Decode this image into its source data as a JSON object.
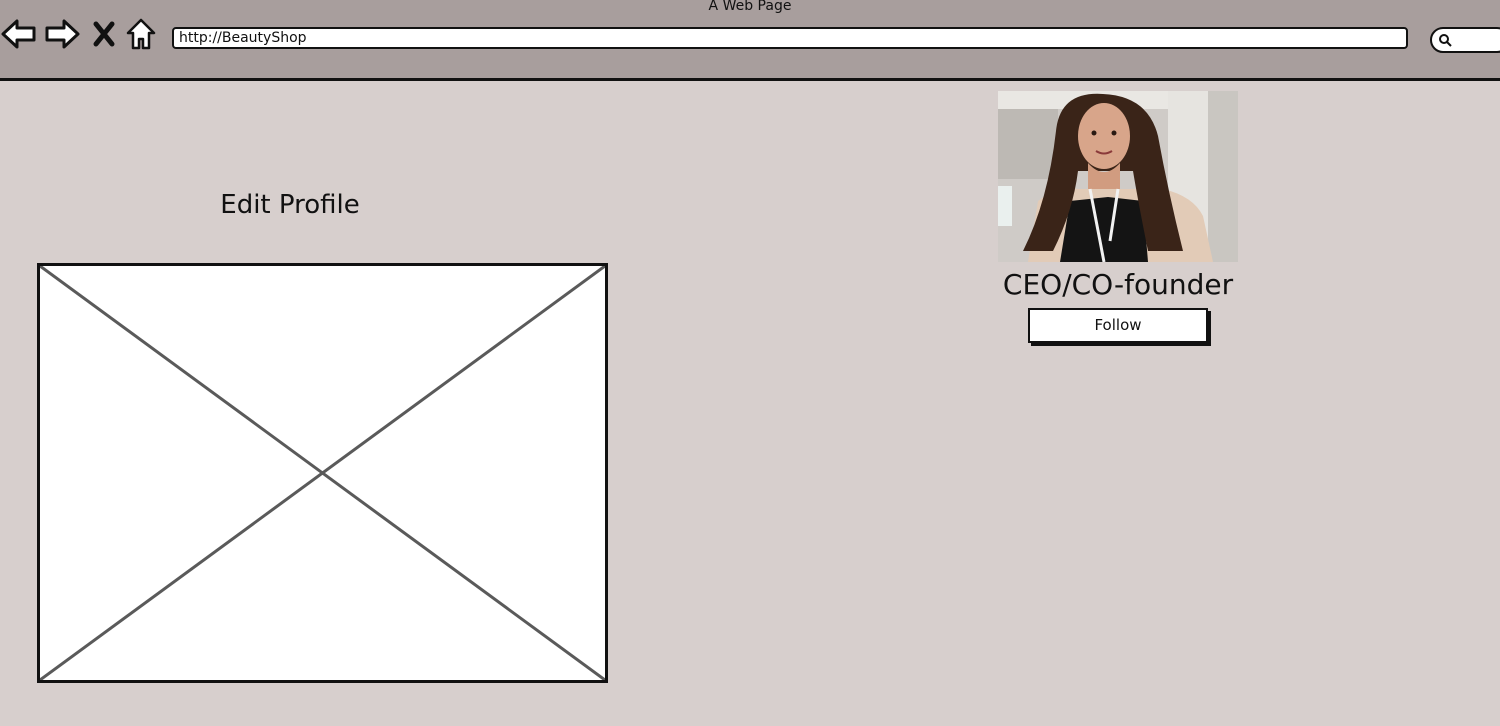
{
  "window": {
    "title": "A Web Page"
  },
  "toolbar": {
    "back_icon": "arrow-left-icon",
    "forward_icon": "arrow-right-icon",
    "stop_icon": "close-icon",
    "home_icon": "home-icon",
    "search_icon": "search-icon",
    "url": "http://BeautyShop"
  },
  "main": {
    "heading": "Edit Profile",
    "image_placeholder_icon": "image-placeholder-icon"
  },
  "profile": {
    "role": "CEO/CO-founder",
    "follow_label": "Follow"
  },
  "colors": {
    "chrome_background": "#a89e9d",
    "page_background": "#d7cfcd",
    "border": "#111111"
  }
}
